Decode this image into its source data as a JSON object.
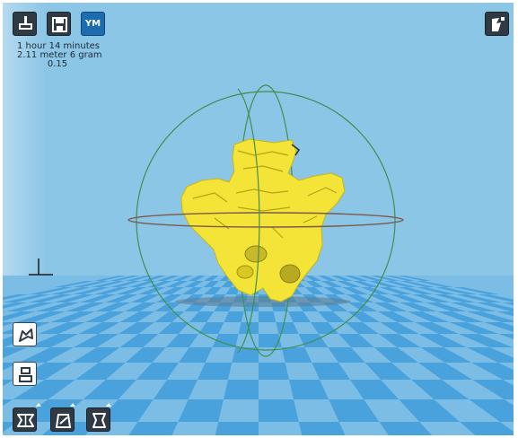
{
  "toolbar": {
    "load_icon": "load-model-icon",
    "save_icon": "save-icon",
    "logo_text": "YM",
    "view_mode_icon": "view-mode-icon"
  },
  "print_info": {
    "time": "1 hour 14 minutes",
    "filament": "2.11 meter 6 gram",
    "cost": "0.15"
  },
  "tools": {
    "rotate_icon": "rotate-icon",
    "scale_icon": "scale-icon",
    "move_icon": "move-icon",
    "mirror_icon": "mirror-icon",
    "settings_icon": "model-settings-icon"
  },
  "colors": {
    "background": "#8cc6e7",
    "model": "#f4e437",
    "grid_dark": "#4aa2dd",
    "grid_light": "#8dc8ef",
    "ring_vertical": "#3f8f4f",
    "ring_horizontal": "#7a5a4a"
  }
}
